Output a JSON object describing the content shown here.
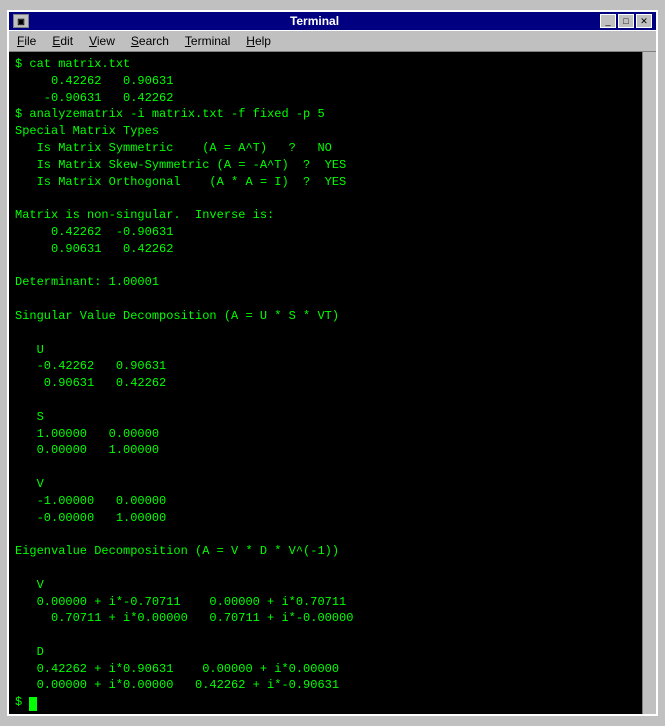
{
  "window": {
    "title": "Terminal",
    "icon": "▣"
  },
  "title_bar_controls": {
    "minimize": "_",
    "maximize": "□",
    "close": "✕"
  },
  "menu": {
    "items": [
      {
        "label": "File",
        "underline_index": 0
      },
      {
        "label": "Edit",
        "underline_index": 0
      },
      {
        "label": "View",
        "underline_index": 0
      },
      {
        "label": "Search",
        "underline_index": 0
      },
      {
        "label": "Terminal",
        "underline_index": 0
      },
      {
        "label": "Help",
        "underline_index": 0
      }
    ]
  },
  "terminal": {
    "content": "$ cat matrix.txt\n     0.42262   0.90631\n    -0.90631   0.42262\n$ analyzematrix -i matrix.txt -f fixed -p 5\nSpecial Matrix Types\n   Is Matrix Symmetric    (A = A^T)   ?   NO\n   Is Matrix Skew-Symmetric (A = -A^T)  ?  YES\n   Is Matrix Orthogonal    (A * A = I)  ?  YES\n\nMatrix is non-singular.  Inverse is:\n     0.42262  -0.90631\n     0.90631   0.42262\n\nDeterminant: 1.00001\n\nSingular Value Decomposition (A = U * S * VT)\n\n   U\n   -0.42262   0.90631\n    0.90631   0.42262\n\n   S\n   1.00000   0.00000\n   0.00000   1.00000\n\n   V\n   -1.00000   0.00000\n   -0.00000   1.00000\n\nEigenvalue Decomposition (A = V * D * V^(-1))\n\n   V\n   0.00000 + i*-0.70711    0.00000 + i*0.70711\n     0.70711 + i*0.00000   0.70711 + i*-0.00000\n\n   D\n   0.42262 + i*0.90631    0.00000 + i*0.00000\n   0.00000 + i*0.00000   0.42262 + i*-0.90631\n$ "
  }
}
